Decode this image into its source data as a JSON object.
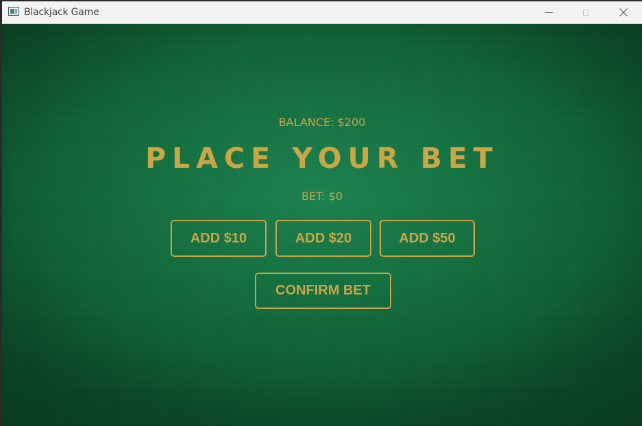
{
  "window": {
    "title": "Blackjack Game",
    "controls": {
      "minimize_icon": "minimize-icon",
      "maximize_icon": "maximize-icon",
      "close_icon": "close-icon"
    }
  },
  "table": {
    "balance_label": "BALANCE: $200",
    "headline": "PLACE YOUR BET",
    "bet_label": "BET: $0",
    "bet_buttons": [
      {
        "label": "ADD $10"
      },
      {
        "label": "ADD $20"
      },
      {
        "label": "ADD $50"
      }
    ],
    "confirm_label": "CONFIRM BET"
  },
  "colors": {
    "felt": "#14703f",
    "gold": "#c9a646",
    "titlebar": "#f3f3f3"
  }
}
